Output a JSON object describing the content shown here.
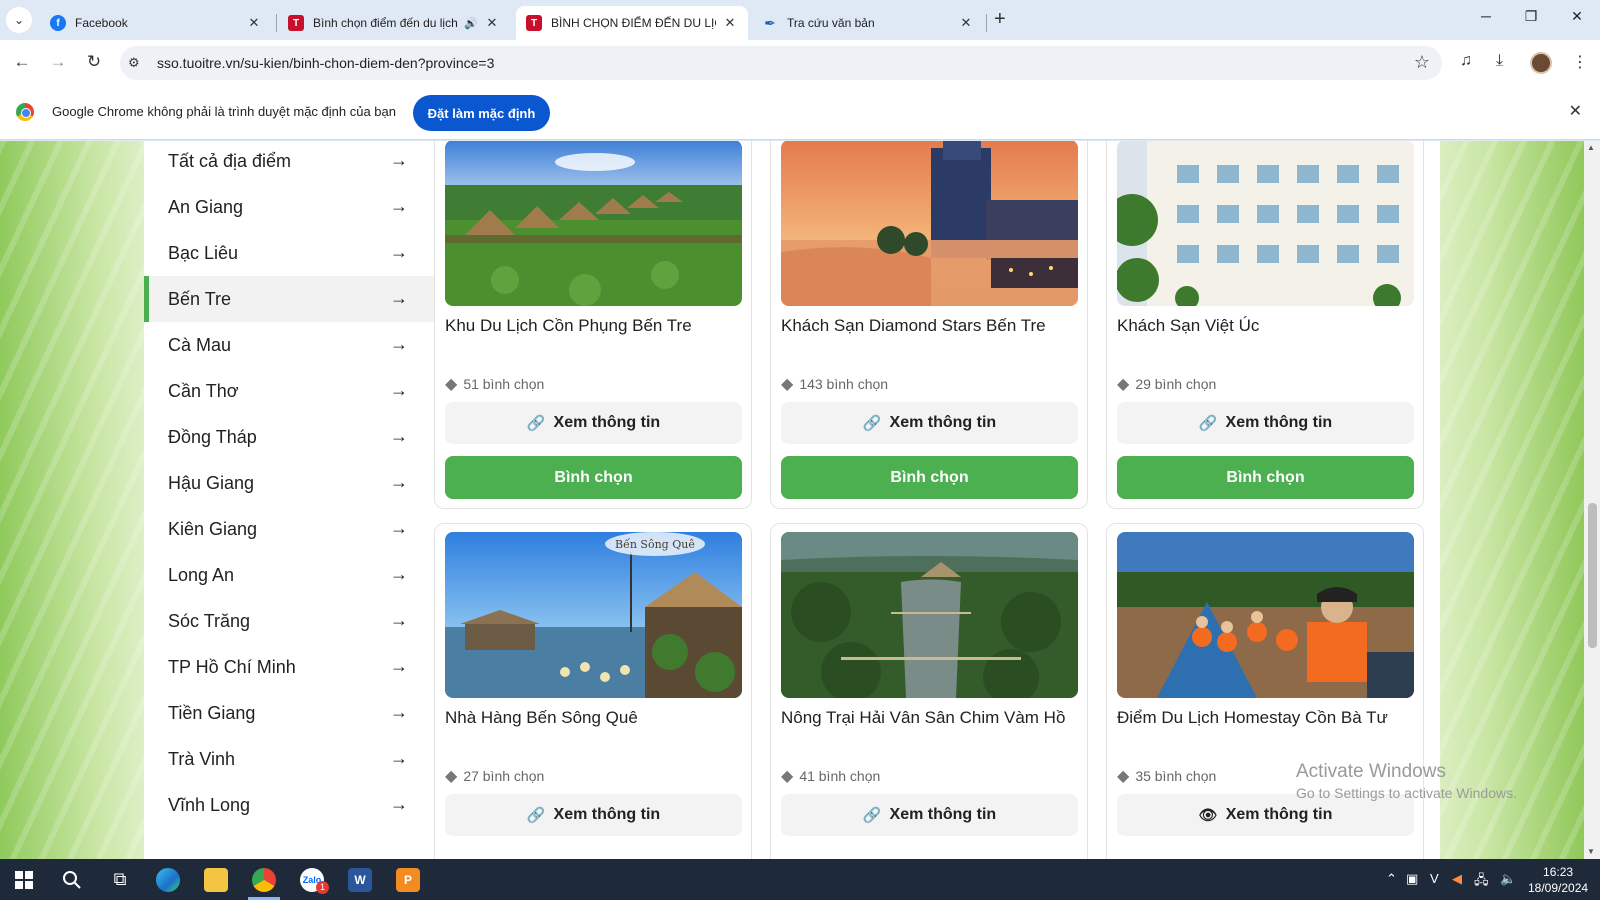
{
  "browser": {
    "tabs": [
      {
        "title": "Facebook",
        "favicon": "facebook-icon",
        "active": false
      },
      {
        "title": "Bình chọn điểm đến du lịch",
        "favicon": "tuoitre-icon",
        "active": false,
        "audio": true
      },
      {
        "title": "BÌNH CHỌN ĐIỂM ĐẾN DU LỊCH",
        "favicon": "tuoitre-icon",
        "active": true
      },
      {
        "title": "Tra cứu văn bản",
        "favicon": "feather-icon",
        "active": false
      }
    ],
    "url": "sso.tuoitre.vn/su-kien/binh-chon-diem-den?province=3",
    "infobar": {
      "message": "Google Chrome không phải là trình duyệt mặc định của bạn",
      "button": "Đặt làm mặc định"
    }
  },
  "sidebar": {
    "items": [
      {
        "label": "Tất cả địa điểm"
      },
      {
        "label": "An Giang"
      },
      {
        "label": "Bạc Liêu"
      },
      {
        "label": "Bến Tre",
        "active": true
      },
      {
        "label": "Cà Mau"
      },
      {
        "label": "Cần Thơ"
      },
      {
        "label": "Đồng Tháp"
      },
      {
        "label": "Hậu Giang"
      },
      {
        "label": "Kiên Giang"
      },
      {
        "label": "Long An"
      },
      {
        "label": "Sóc Trăng"
      },
      {
        "label": "TP Hồ Chí Minh"
      },
      {
        "label": "Tiền Giang"
      },
      {
        "label": "Trà Vinh"
      },
      {
        "label": "Vĩnh Long"
      }
    ]
  },
  "cards": [
    {
      "name": "Khu Du Lịch Cồn Phụng Bến Tre",
      "votes": "51 bình chọn",
      "info": "Xem thông tin",
      "vote": "Bình chọn",
      "icon": "link-icon"
    },
    {
      "name": "Khách Sạn Diamond Stars Bến Tre",
      "votes": "143 bình chọn",
      "info": "Xem thông tin",
      "vote": "Bình chọn",
      "icon": "link-icon"
    },
    {
      "name": "Khách Sạn Việt Úc",
      "votes": "29 bình chọn",
      "info": "Xem thông tin",
      "vote": "Bình chọn",
      "icon": "link-icon"
    },
    {
      "name": "Nhà Hàng Bến Sông Quê",
      "votes": "27 bình chọn",
      "info": "Xem thông tin",
      "icon": "link-icon",
      "photo_sign": "Bến Sông Quê"
    },
    {
      "name": "Nông Trại Hải Vân Sân Chim Vàm Hồ",
      "votes": "41 bình chọn",
      "info": "Xem thông tin",
      "icon": "link-icon"
    },
    {
      "name": "Điểm Du Lịch Homestay Cồn Bà Tư",
      "votes": "35 bình chọn",
      "info": "Xem thông tin",
      "icon": "eye-icon"
    }
  ],
  "watermark": {
    "line1": "Activate Windows",
    "line2": "Go to Settings to activate Windows."
  },
  "taskbar": {
    "time": "16:23",
    "date": "18/09/2024",
    "zalo_badge": "1"
  },
  "colors": {
    "accent_green": "#4caf50",
    "chrome_blue": "#0b57d0",
    "tuoitre_red": "#c8102e"
  }
}
